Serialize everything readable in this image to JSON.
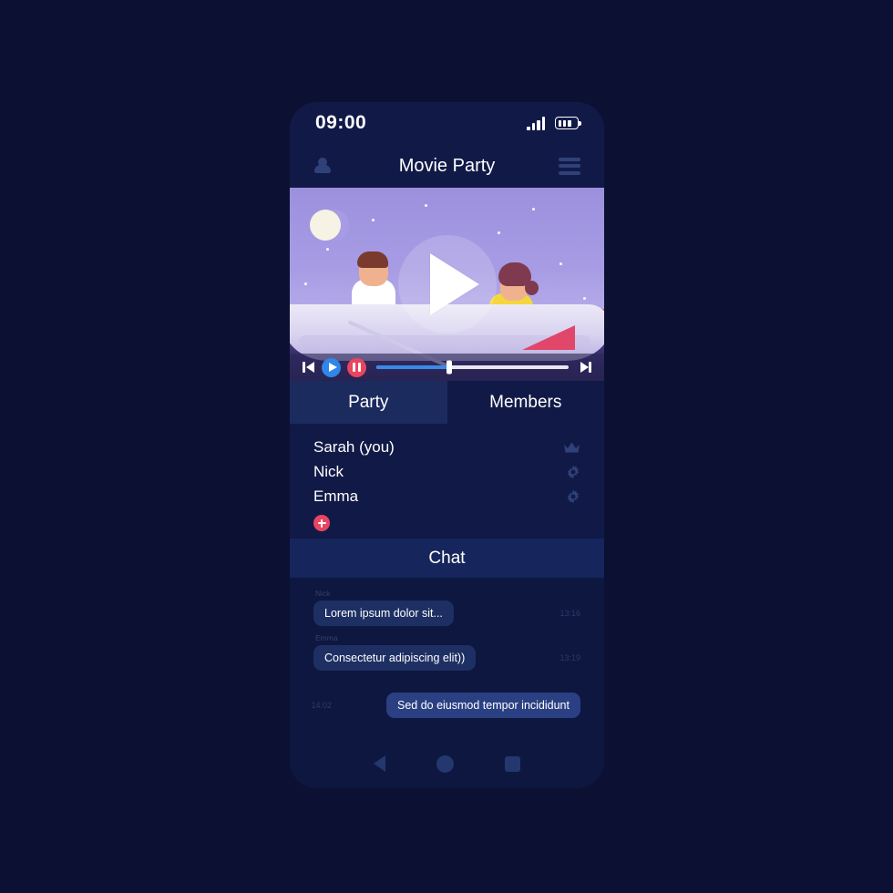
{
  "status_bar": {
    "time": "09:00",
    "signal_icon": "signal-bars-icon",
    "battery_icon": "battery-icon"
  },
  "header": {
    "title": "Movie Party",
    "profile_icon": "person-icon",
    "menu_icon": "hamburger-menu-icon"
  },
  "video": {
    "play_overlay_icon": "play-icon",
    "scene_description": "Couple rowing a boat at night under a crescent moon",
    "controls": {
      "skip_back_icon": "skip-previous-icon",
      "play_icon": "play-icon",
      "pause_icon": "pause-icon",
      "skip_forward_icon": "skip-next-icon",
      "progress_percent": 38
    }
  },
  "tabs": [
    {
      "label": "Party",
      "active": true
    },
    {
      "label": "Members",
      "active": false
    }
  ],
  "party": {
    "members": [
      {
        "name": "Sarah (you)",
        "role_icon": "crown-icon"
      },
      {
        "name": "Nick",
        "role_icon": "gear-icon"
      },
      {
        "name": "Emma",
        "role_icon": "gear-icon"
      }
    ],
    "add_button_icon": "plus-icon"
  },
  "chat": {
    "header": "Chat",
    "messages": [
      {
        "sender": "Nick",
        "text": "Lorem ipsum dolor sit...",
        "time": "13:16",
        "outgoing": false
      },
      {
        "sender": "Emma",
        "text": "Consectetur adipiscing elit))",
        "time": "13:19",
        "outgoing": false
      },
      {
        "sender": "",
        "text": "Sed do eiusmod tempor incididunt",
        "time": "14:02",
        "outgoing": true
      }
    ]
  },
  "nav_bar": {
    "back_icon": "back-triangle-icon",
    "home_icon": "home-circle-icon",
    "recents_icon": "recents-square-icon"
  },
  "colors": {
    "page_bg": "#0c1133",
    "phone_bg": "#111a47",
    "accent_red": "#e94560",
    "accent_blue": "#2f86e8",
    "tab_active": "#1c2b5e",
    "chat_header": "#16265c",
    "bubble_in": "#1e2f63",
    "bubble_out": "#2a4083"
  }
}
